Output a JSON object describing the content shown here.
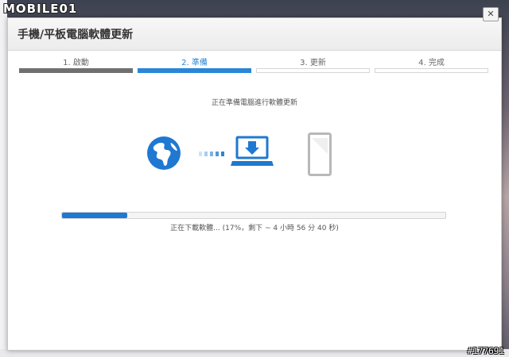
{
  "watermark": {
    "logo": "MOBILE01",
    "id": "#177691"
  },
  "dialog": {
    "title": "手機/平板電腦軟體更新",
    "close_label": "✕"
  },
  "steps": [
    {
      "label": "1. 啟動",
      "state": "done"
    },
    {
      "label": "2. 準備",
      "state": "active"
    },
    {
      "label": "3. 更新",
      "state": "pending"
    },
    {
      "label": "4. 完成",
      "state": "pending"
    }
  ],
  "status_text": "正在準備電腦進行軟體更新",
  "progress": {
    "fraction": 0.17,
    "text": "正在下載軟體... (17%，剩下 ~ 4 小時 56 分 40 秒)"
  },
  "icons": [
    "globe-icon",
    "transfer-dots-icon",
    "laptop-download-icon",
    "phone-icon"
  ],
  "colors": {
    "accent": "#2a86d6",
    "progress": "#1f78d1",
    "done": "#707070"
  }
}
